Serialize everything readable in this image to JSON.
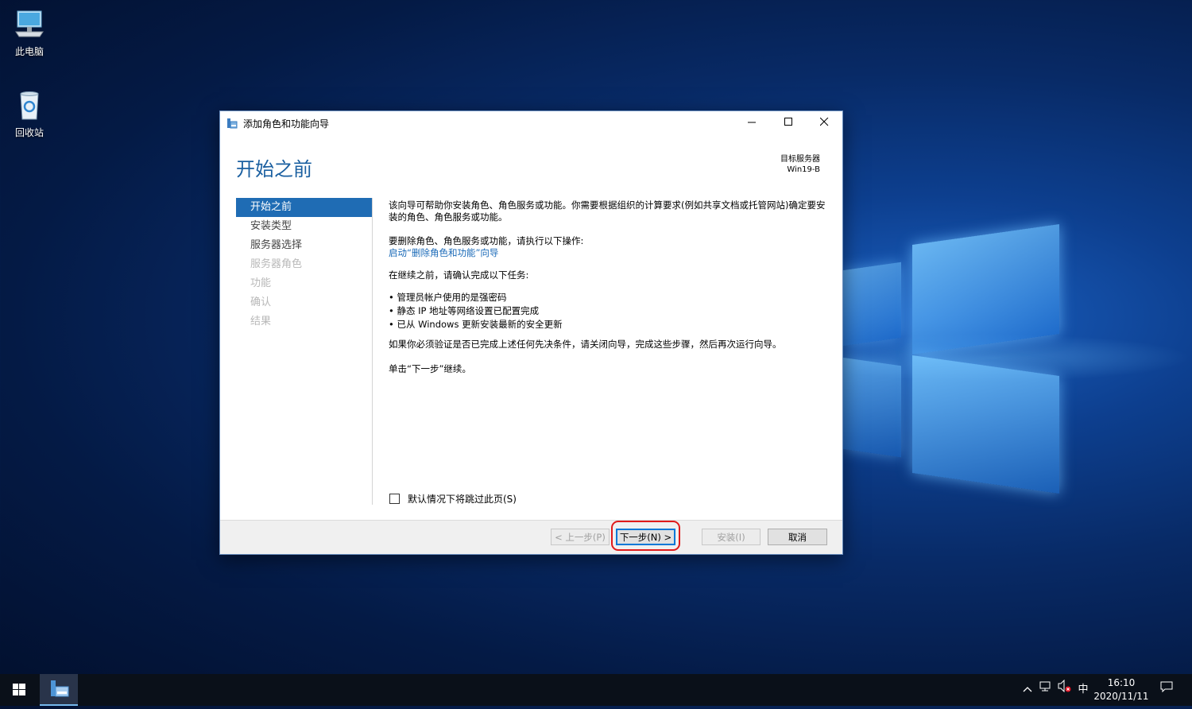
{
  "desktop": {
    "icons": [
      {
        "label": "此电脑",
        "icon": "computer-icon"
      },
      {
        "label": "回收站",
        "icon": "recycle-bin-icon"
      }
    ]
  },
  "window": {
    "title": "添加角色和功能向导",
    "heading": "开始之前",
    "target_server_label": "目标服务器",
    "target_server_name": "Win19-B",
    "nav": [
      {
        "label": "开始之前",
        "state": "active"
      },
      {
        "label": "安装类型",
        "state": "enabled"
      },
      {
        "label": "服务器选择",
        "state": "enabled"
      },
      {
        "label": "服务器角色",
        "state": "disabled"
      },
      {
        "label": "功能",
        "state": "disabled"
      },
      {
        "label": "确认",
        "state": "disabled"
      },
      {
        "label": "结果",
        "state": "disabled"
      }
    ],
    "content": {
      "intro": "该向导可帮助你安装角色、角色服务或功能。你需要根据组织的计算要求(例如共享文档或托管网站)确定要安装的角色、角色服务或功能。",
      "remove_heading": "要删除角色、角色服务或功能，请执行以下操作:",
      "remove_link": "启动“删除角色和功能”向导",
      "verify_heading": "在继续之前，请确认完成以下任务:",
      "tasks": [
        "管理员帐户使用的是强密码",
        "静态 IP 地址等网络设置已配置完成",
        "已从 Windows 更新安装最新的安全更新"
      ],
      "prereq_note": "如果你必须验证是否已完成上述任何先决条件，请关闭向导，完成这些步骤，然后再次运行向导。",
      "continue_note": "单击“下一步”继续。"
    },
    "skip_checkbox_label": "默认情况下将跳过此页(S)",
    "buttons": {
      "previous": "< 上一步(P)",
      "next": "下一步(N) >",
      "install": "安装(I)",
      "cancel": "取消"
    }
  },
  "taskbar": {
    "ime": "中",
    "time": "16:10",
    "date": "2020/11/11"
  },
  "colors": {
    "accent": "#1f6cb4",
    "heading": "#1a5fa0",
    "link": "#1a6ab8",
    "highlight": "#e01b1b"
  }
}
